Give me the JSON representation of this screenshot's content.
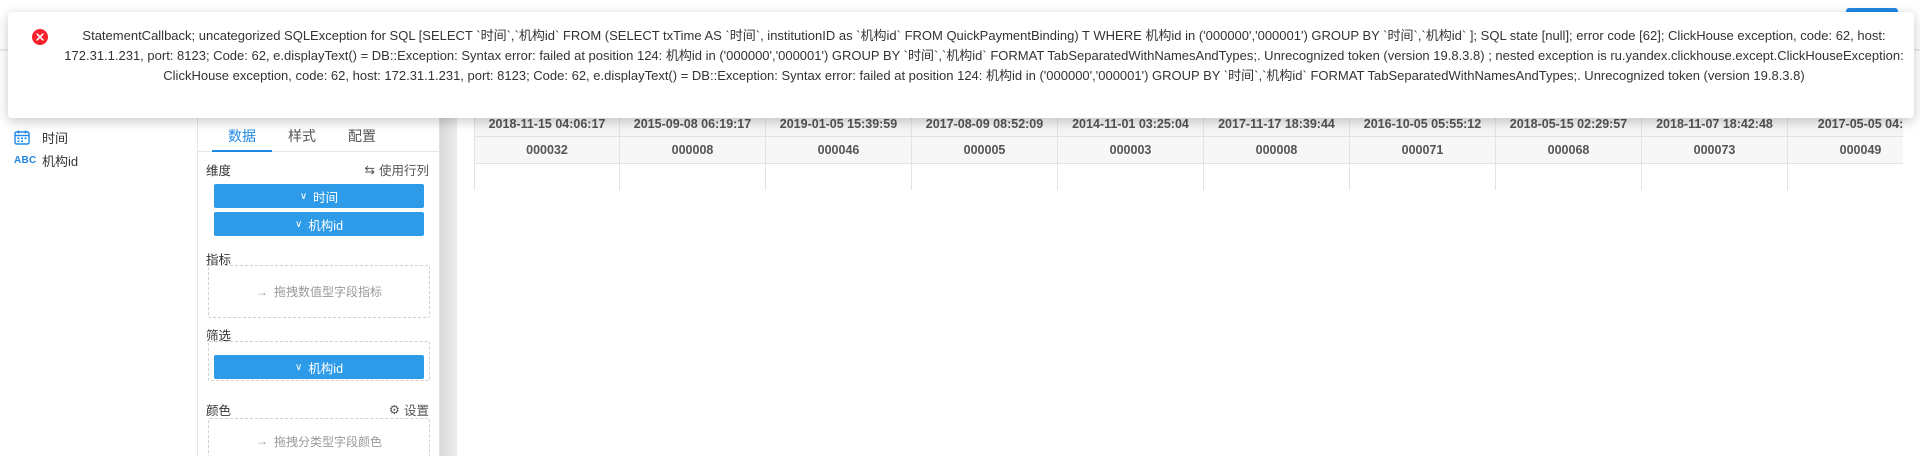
{
  "error": {
    "message": "StatementCallback; uncategorized SQLException for SQL [SELECT `时间`,`机构id` FROM (SELECT txTime AS `时间`, institutionID as `机构id` FROM QuickPaymentBinding) T WHERE 机构id in ('000000','000001') GROUP BY `时间`,`机构id` ]; SQL state [null]; error code [62]; ClickHouse exception, code: 62, host: 172.31.1.231, port: 8123; Code: 62, e.displayText() = DB::Exception: Syntax error: failed at position 124: 机构id in ('000000','000001') GROUP BY `时间`,`机构id` FORMAT TabSeparatedWithNamesAndTypes;. Unrecognized token (version 19.8.3.8) ; nested exception is ru.yandex.clickhouse.except.ClickHouseException: ClickHouse exception, code: 62, host: 172.31.1.231, port: 8123; Code: 62, e.displayText() = DB::Exception: Syntax error: failed at position 124: 机构id in ('000000','000001') GROUP BY `时间`,`机构id` FORMAT TabSeparatedWithNamesAndTypes;. Unrecognized token (version 19.8.3.8)",
    "icon": "error-circle-icon",
    "color": "#f5222d"
  },
  "fields": [
    {
      "label": "时间",
      "icon": "calendar-icon"
    },
    {
      "label": "机构id",
      "icon": "abc-icon",
      "icon_text": "ABC"
    }
  ],
  "config": {
    "tabs": [
      {
        "label": "数据",
        "active": true
      },
      {
        "label": "样式",
        "active": false
      },
      {
        "label": "配置",
        "active": false
      }
    ],
    "dimensions": {
      "label": "维度",
      "action_label": "使用行列",
      "items": [
        "时间",
        "机构id"
      ]
    },
    "metrics": {
      "label": "指标",
      "drop_hint": "拖拽数值型字段指标"
    },
    "filters": {
      "label": "筛选",
      "items": [
        "机构id"
      ]
    },
    "color": {
      "label": "颜色",
      "action_label": "设置",
      "drop_hint": "拖拽分类型字段颜色"
    }
  },
  "table": {
    "times": [
      "2018-11-15 04:06:17",
      "2015-09-08 06:19:17",
      "2019-01-05 15:39:59",
      "2017-08-09 08:52:09",
      "2014-11-01 03:25:04",
      "2017-11-17 18:39:44",
      "2016-10-05 05:55:12",
      "2018-05-15 02:29:57",
      "2018-11-07 18:42:48",
      "2017-05-05 04:"
    ],
    "ids": [
      "000032",
      "000008",
      "000046",
      "000005",
      "000003",
      "000008",
      "000071",
      "000068",
      "000073",
      "000049"
    ]
  },
  "colors": {
    "accent": "#1e88e5",
    "pill": "#2d9be8",
    "error": "#f5222d"
  }
}
